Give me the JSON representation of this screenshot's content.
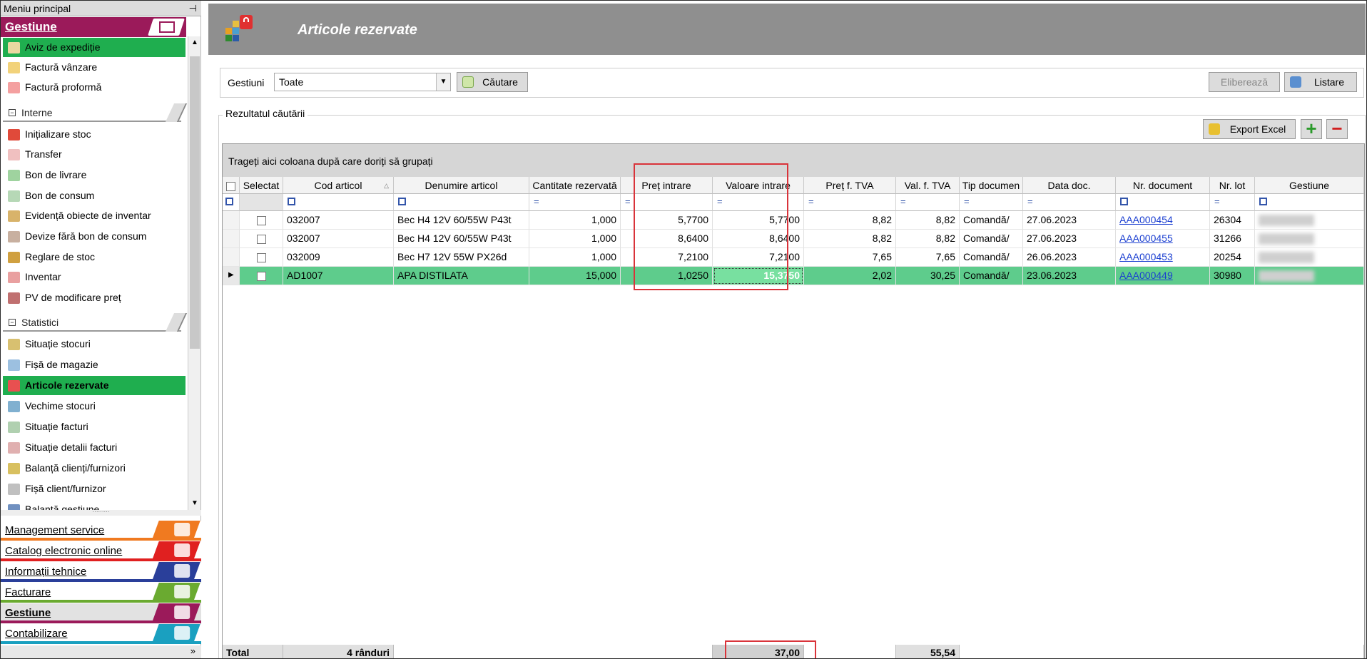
{
  "sidebar": {
    "title": "Meniu principal",
    "pin_icon": "pin-icon",
    "top_section": "Gestiune",
    "items_top": [
      "Aviz de expediție",
      "Factură vânzare",
      "Factură proformă"
    ],
    "group_interne": "Interne",
    "items_interne": [
      "Inițializare stoc",
      "Transfer",
      "Bon de livrare",
      "Bon de consum",
      "Evidență obiecte de inventar",
      "Devize fără bon de consum",
      "Reglare de stoc",
      "Inventar",
      "PV de modificare preț"
    ],
    "group_statistici": "Statistici",
    "items_statistici": [
      "Situație stocuri",
      "Fișă de magazie",
      "Articole rezervate",
      "Vechime stocuri",
      "Situație facturi",
      "Situație detalii facturi",
      "Balanță clienți/furnizori",
      "Fișă client/furnizor",
      "Balanță gestiune"
    ],
    "modules": [
      "Management service",
      "Catalog electronic online",
      "Informații tehnice",
      "Facturare",
      "Gestiune",
      "Contabilizare"
    ],
    "collapse_glyph": "»"
  },
  "page": {
    "title": "Articole rezervate"
  },
  "filter": {
    "label": "Gestiuni",
    "selected": "Toate",
    "search_button": "Căutare",
    "release_button": "Eliberează",
    "print_button": "Listare"
  },
  "results": {
    "group_label": "Rezultatul căutării",
    "export_button": "Export Excel",
    "group_hint": "Trageți aici coloana după care doriți să grupați",
    "columns": [
      "Selectat",
      "Cod articol",
      "Denumire articol",
      "Cantitate rezervată",
      "Preț intrare",
      "Valoare intrare",
      "Preț f. TVA",
      "Val. f. TVA",
      "Tip documen",
      "Data doc.",
      "Nr. document",
      "Nr. lot",
      "Gestiune"
    ],
    "rows": [
      {
        "cod": "032007",
        "den": "Bec H4 12V 60/55W P43t",
        "cant": "1,000",
        "pret": "5,7700",
        "val": "5,7700",
        "pret_ftva": "8,82",
        "val_ftva": "8,82",
        "tip": "Comandă/",
        "data": "27.06.2023",
        "nr": "AAA000454",
        "lot": "26304"
      },
      {
        "cod": "032007",
        "den": "Bec H4 12V 60/55W P43t",
        "cant": "1,000",
        "pret": "8,6400",
        "val": "8,6400",
        "pret_ftva": "8,82",
        "val_ftva": "8,82",
        "tip": "Comandă/",
        "data": "27.06.2023",
        "nr": "AAA000455",
        "lot": "31266"
      },
      {
        "cod": "032009",
        "den": "Bec H7 12V 55W PX26d",
        "cant": "1,000",
        "pret": "7,2100",
        "val": "7,2100",
        "pret_ftva": "7,65",
        "val_ftva": "7,65",
        "tip": "Comandă/",
        "data": "26.06.2023",
        "nr": "AAA000453",
        "lot": "20254"
      },
      {
        "cod": "AD1007",
        "den": "APA DISTILATA",
        "cant": "15,000",
        "pret": "1,0250",
        "val": "15,3750",
        "pret_ftva": "2,02",
        "val_ftva": "30,25",
        "tip": "Comandă/",
        "data": "23.06.2023",
        "nr": "AAA000449",
        "lot": "30980"
      }
    ],
    "total_label": "Total",
    "total_rows": "4 rânduri",
    "total_valoare": "37,00",
    "total_val_ftva": "55,54"
  },
  "colors": {
    "accent_gestiune": "#9b1a5a",
    "active_item": "#1fae4f",
    "selected_row": "#5ecc8c",
    "highlight_box": "#d9333a"
  }
}
